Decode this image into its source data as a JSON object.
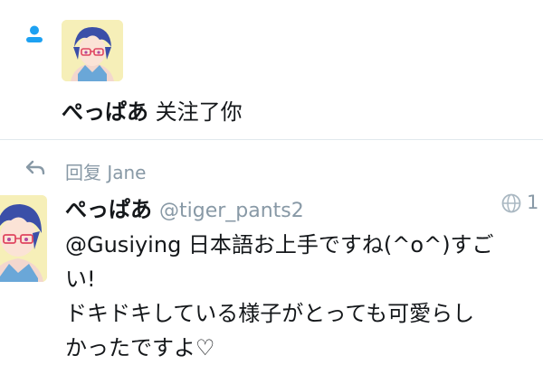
{
  "notification": {
    "follower_name": "ぺっぱあ",
    "action_text": " 关注了你",
    "icon": "person-icon",
    "accent": "#1da1f2"
  },
  "reply_context": {
    "icon": "reply-arrow-icon",
    "text": "回复 Jane"
  },
  "tweet": {
    "name": "ぺっぱあ",
    "handle": "@tiger_pants2",
    "time": "1",
    "globe_icon": "globe-icon",
    "lines": [
      "@Gusiying 日本語お上手ですね(^o^)すご",
      "い!",
      "ドキドキしている様子がとっても可愛らし",
      "かったですよ♡"
    ]
  },
  "colors": {
    "text": "#14171a",
    "secondary": "#8899a6",
    "divider": "#e1e8ed",
    "avatar_bg": "#f6efb8"
  }
}
